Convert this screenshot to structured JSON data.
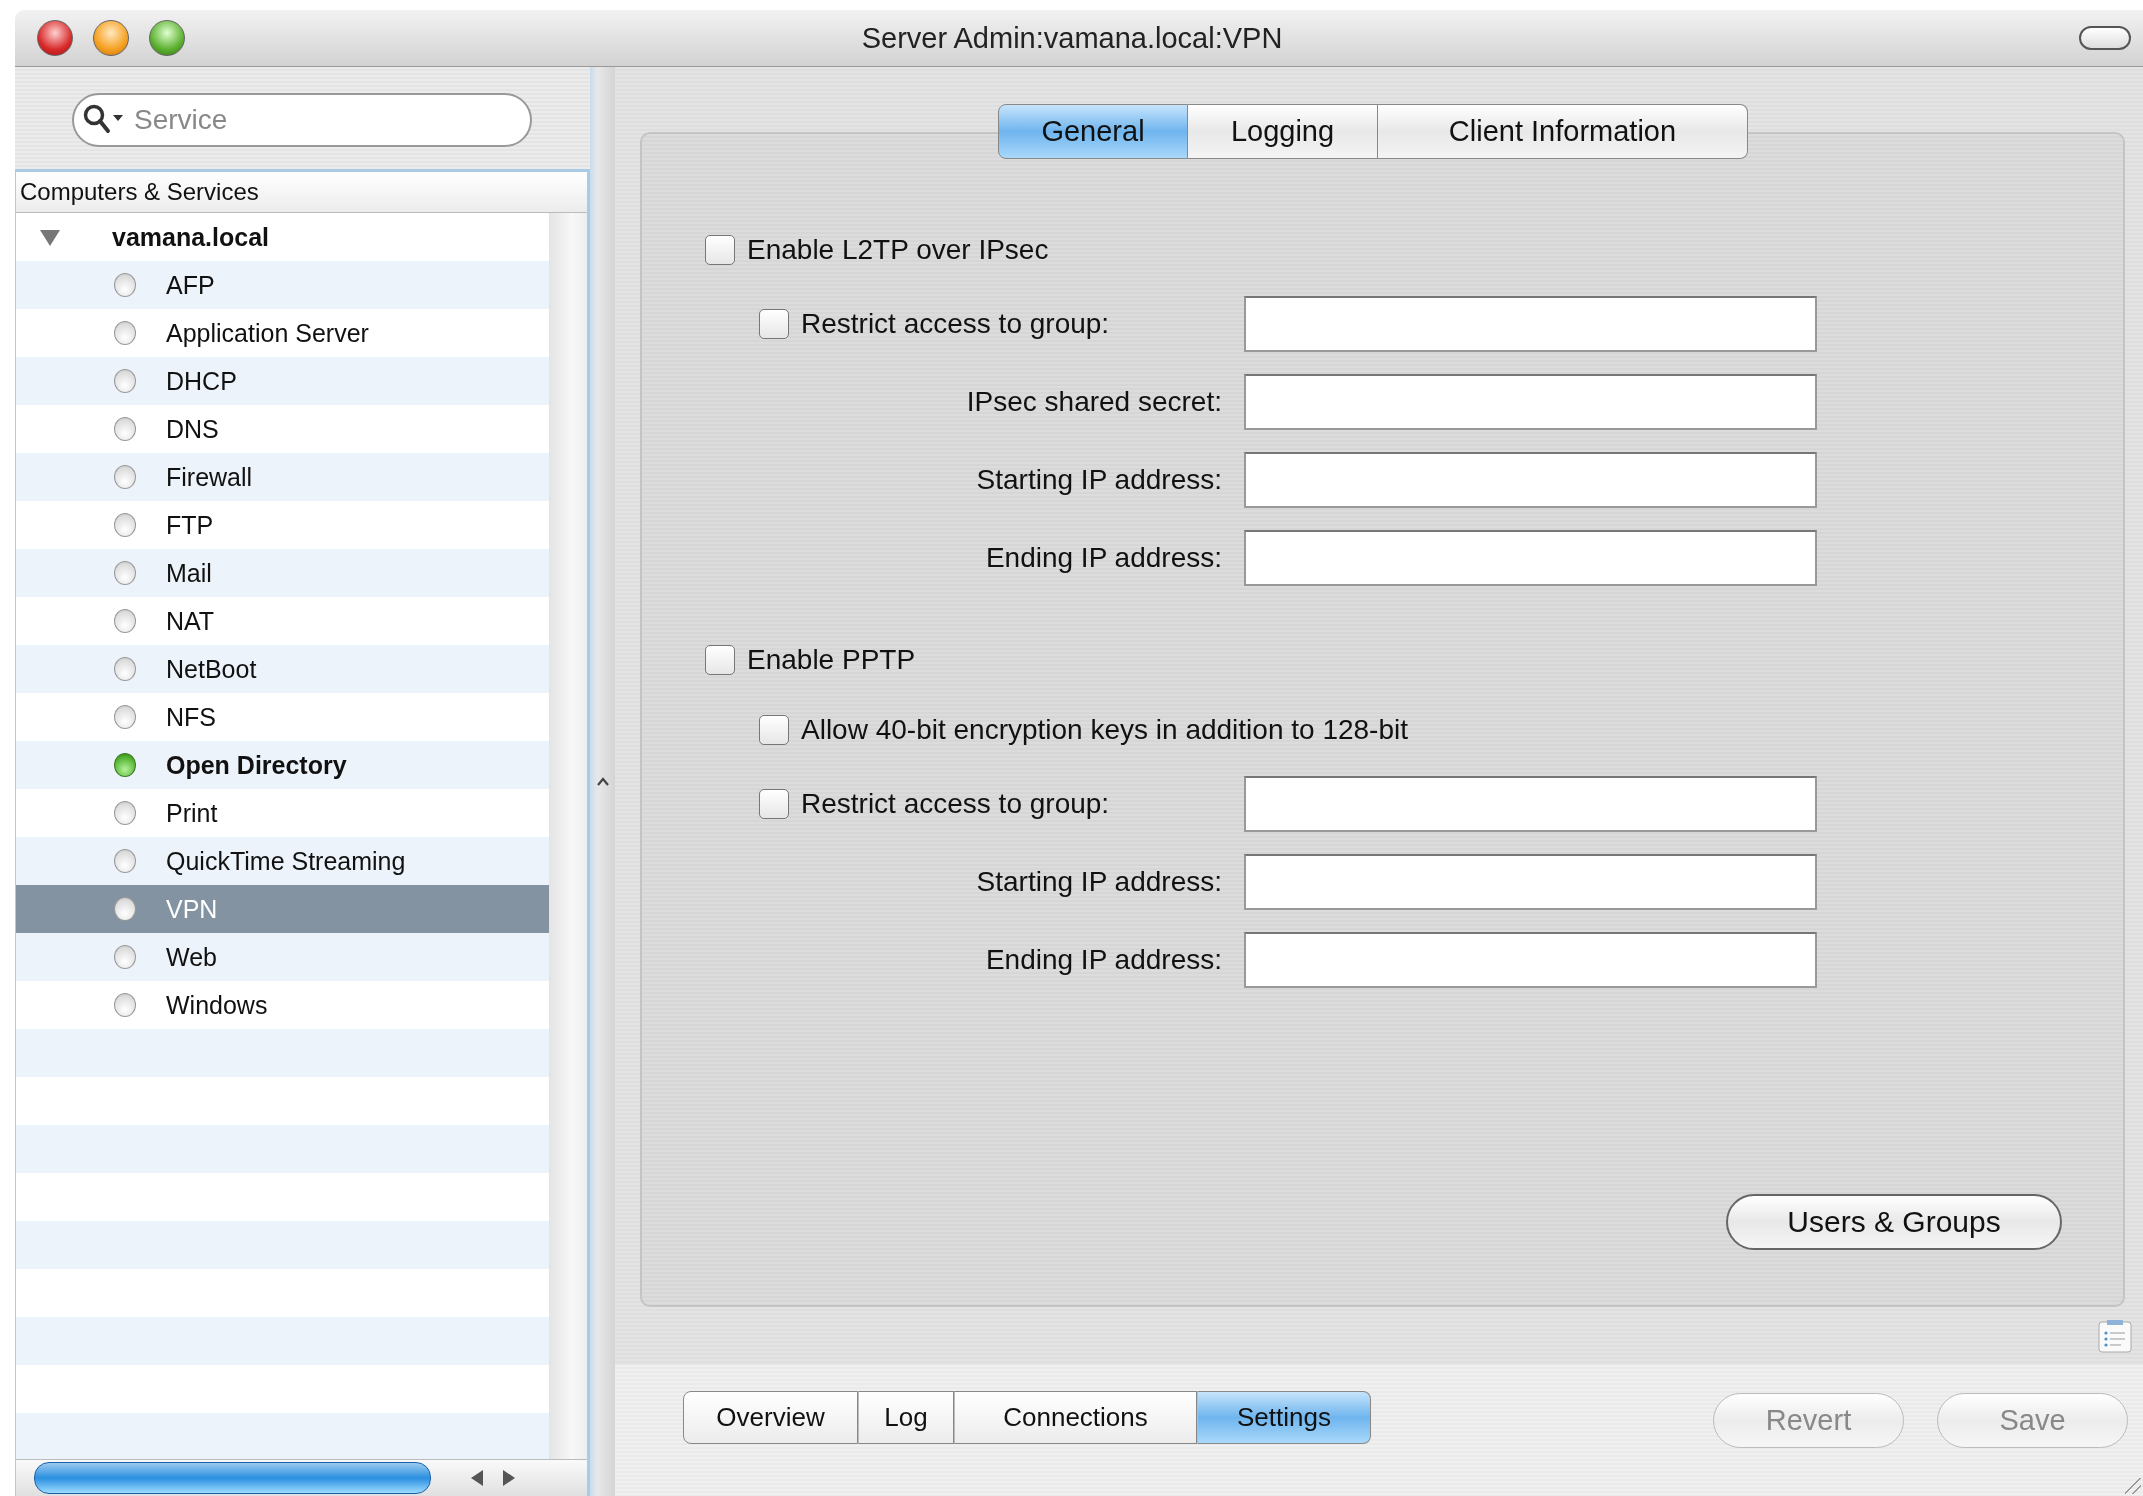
{
  "window": {
    "title": "Server Admin:vamana.local:VPN"
  },
  "sidebar": {
    "search": {
      "placeholder": "Service"
    },
    "list_header": "Computers & Services",
    "tree": [
      {
        "label": "vamana.local",
        "expanded": true,
        "selected": false,
        "children": [
          {
            "label": "AFP",
            "running": false,
            "selected": false
          },
          {
            "label": "Application Server",
            "running": false,
            "selected": false
          },
          {
            "label": "DHCP",
            "running": false,
            "selected": false
          },
          {
            "label": "DNS",
            "running": false,
            "selected": false
          },
          {
            "label": "Firewall",
            "running": false,
            "selected": false
          },
          {
            "label": "FTP",
            "running": false,
            "selected": false
          },
          {
            "label": "Mail",
            "running": false,
            "selected": false
          },
          {
            "label": "NAT",
            "running": false,
            "selected": false
          },
          {
            "label": "NetBoot",
            "running": false,
            "selected": false
          },
          {
            "label": "NFS",
            "running": false,
            "selected": false
          },
          {
            "label": "Open Directory",
            "running": true,
            "selected": false
          },
          {
            "label": "Print",
            "running": false,
            "selected": false
          },
          {
            "label": "QuickTime Streaming",
            "running": false,
            "selected": false
          },
          {
            "label": "VPN",
            "running": false,
            "selected": true
          },
          {
            "label": "Web",
            "running": false,
            "selected": false
          },
          {
            "label": "Windows",
            "running": false,
            "selected": false
          }
        ]
      }
    ]
  },
  "tabs": [
    {
      "label": "General",
      "selected": true
    },
    {
      "label": "Logging",
      "selected": false
    },
    {
      "label": "Client Information",
      "selected": false
    }
  ],
  "sections": [
    {
      "label": "Enable L2TP over IPsec",
      "checked": false,
      "children": [
        {
          "kind": "checkbox_field",
          "label": "Restrict access to group:",
          "checked": false
        },
        {
          "kind": "field",
          "label": "IPsec shared secret:"
        },
        {
          "kind": "field",
          "label": "Starting IP address:"
        },
        {
          "kind": "field",
          "label": "Ending IP address:"
        }
      ]
    },
    {
      "label": "Enable PPTP",
      "checked": false,
      "children": [
        {
          "kind": "checkbox",
          "label": "Allow 40-bit encryption keys in addition to 128-bit",
          "checked": false
        },
        {
          "kind": "checkbox_field",
          "label": "Restrict access to group:",
          "checked": false
        },
        {
          "kind": "field",
          "label": "Starting IP address:"
        },
        {
          "kind": "field",
          "label": "Ending IP address:"
        }
      ]
    }
  ],
  "users_groups_button": "Users & Groups",
  "view_tabs": [
    {
      "label": "Overview",
      "selected": false
    },
    {
      "label": "Log",
      "selected": false
    },
    {
      "label": "Connections",
      "selected": false
    },
    {
      "label": "Settings",
      "selected": true
    }
  ],
  "buttons": [
    {
      "label": "Revert",
      "disabled": true
    },
    {
      "label": "Save",
      "disabled": true
    }
  ]
}
